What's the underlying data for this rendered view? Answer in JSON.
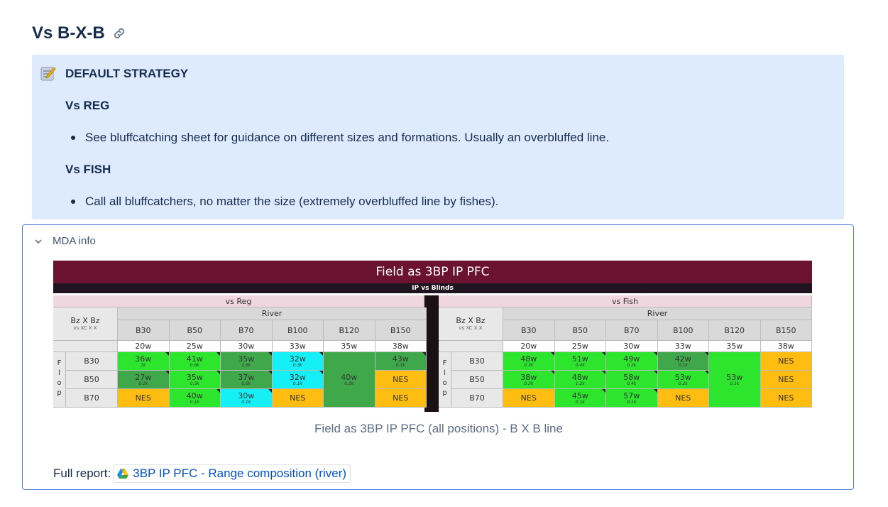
{
  "heading": {
    "title": "Vs B-X-B",
    "link_icon": "link-icon"
  },
  "panel": {
    "icon": "note-icon",
    "title": "DEFAULT STRATEGY",
    "reg_heading": "Vs REG",
    "reg_bullet": "See bluffcatching sheet for guidance on different sizes and formations. Usually an overbluffed line.",
    "fish_heading": "Vs FISH",
    "fish_bullet": "Call all bluffcatchers, no matter the size (extremely overbluffed line by fishes)."
  },
  "expand": {
    "label": "MDA info",
    "chevron_icon": "chevron-down-icon",
    "caption": "Field as 3BP IP PFC (all positions) - B X B line",
    "report_label": "Full report:",
    "report_link": "3BP IP PFC - Range composition (river)",
    "report_icon": "google-drive-icon"
  },
  "chart_data": {
    "type": "table",
    "title": "Field as 3BP IP PFC",
    "subtitle": "IP vs Blinds",
    "corner_label": "Bz X Bz",
    "corner_sub": "vs XC X X",
    "river_label": "River",
    "flop_label": [
      "F",
      "l",
      "o",
      "p"
    ],
    "columns": [
      "B30",
      "B50",
      "B70",
      "B100",
      "B120",
      "B150"
    ],
    "rows": [
      "B30",
      "B50",
      "B70"
    ],
    "colors": {
      "lime": "#2ce52c",
      "dark_green": "#3ea84a",
      "cyan": "#14f0f6",
      "orange": "#ffbd12"
    },
    "panels": [
      {
        "name": "vs Reg",
        "widths": [
          "20w",
          "25w",
          "30w",
          "33w",
          "35w",
          "38w"
        ],
        "cells": [
          [
            {
              "v": "36w",
              "s": "1k",
              "c": "lime"
            },
            {
              "v": "41w",
              "s": "0.8k",
              "c": "lime"
            },
            {
              "v": "35w",
              "s": "1.6k",
              "c": "dgreen"
            },
            {
              "v": "32w",
              "s": "0.3k",
              "c": "cyan"
            },
            null,
            {
              "v": "43w",
              "s": "0.1k",
              "c": "dgreen"
            }
          ],
          [
            {
              "v": "27w",
              "s": "0.2k",
              "c": "dgreen"
            },
            {
              "v": "35w",
              "s": "0.5k",
              "c": "lime"
            },
            {
              "v": "37w",
              "s": "0.6k",
              "c": "dgreen"
            },
            {
              "v": "32w",
              "s": "0.1k",
              "c": "cyan"
            },
            {
              "v": "40w",
              "s": "0.2k",
              "c": "dgreen",
              "span": 3
            },
            {
              "v": "NES",
              "s": "",
              "c": "orange"
            }
          ],
          [
            {
              "v": "NES",
              "s": "",
              "c": "orange"
            },
            {
              "v": "40w",
              "s": "0.1k",
              "c": "lime"
            },
            {
              "v": "30w",
              "s": "0.1k",
              "c": "cyan"
            },
            {
              "v": "NES",
              "s": "",
              "c": "orange"
            },
            null,
            {
              "v": "NES",
              "s": "",
              "c": "orange"
            }
          ]
        ]
      },
      {
        "name": "vs Fish",
        "widths": [
          "20w",
          "25w",
          "30w",
          "33w",
          "35w",
          "38w"
        ],
        "cells": [
          [
            {
              "v": "48w",
              "s": "0.3k",
              "c": "lime"
            },
            {
              "v": "51w",
              "s": "0.4k",
              "c": "lime"
            },
            {
              "v": "49w",
              "s": "0.2k",
              "c": "lime"
            },
            {
              "v": "42w",
              "s": "0.1k",
              "c": "dgreen"
            },
            null,
            {
              "v": "NES",
              "s": "",
              "c": "orange"
            }
          ],
          [
            {
              "v": "38w",
              "s": "0.3k",
              "c": "lime"
            },
            {
              "v": "48w",
              "s": "1.2k",
              "c": "lime"
            },
            {
              "v": "58w",
              "s": "0.4k",
              "c": "lime"
            },
            {
              "v": "53w",
              "s": "0.2k",
              "c": "lime"
            },
            {
              "v": "53w",
              "s": "0.1k",
              "c": "lime",
              "span": 3
            },
            {
              "v": "NES",
              "s": "",
              "c": "orange"
            }
          ],
          [
            {
              "v": "NES",
              "s": "",
              "c": "orange"
            },
            {
              "v": "45w",
              "s": "0.1k",
              "c": "lime"
            },
            {
              "v": "57w",
              "s": "0.1k",
              "c": "lime"
            },
            {
              "v": "NES",
              "s": "",
              "c": "orange"
            },
            null,
            {
              "v": "NES",
              "s": "",
              "c": "orange"
            }
          ]
        ]
      }
    ]
  }
}
